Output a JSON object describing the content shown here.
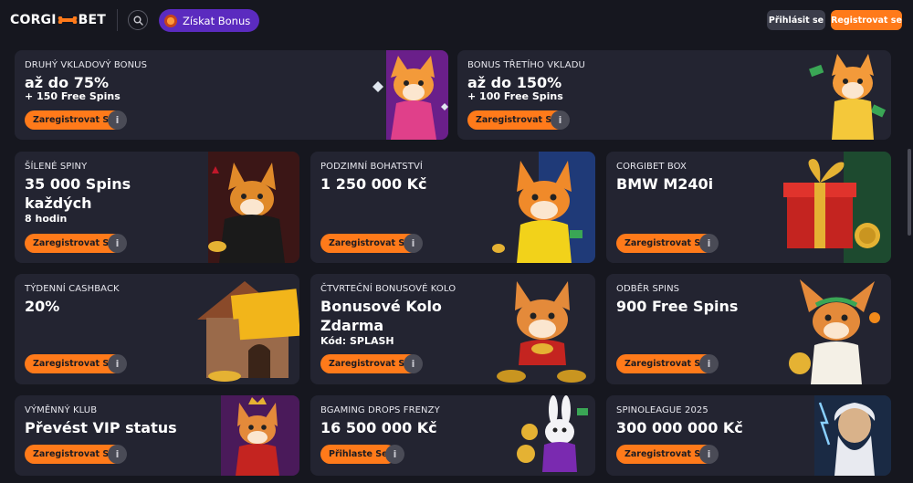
{
  "header": {
    "logo_left": "CORGI",
    "logo_right": "BET",
    "bonus_label": "Získat Bonus",
    "login_label": "Přihlásit se",
    "register_label": "Registrovat se"
  },
  "colors": {
    "accent": "#ff7a1a",
    "card_bg": "#232431",
    "page_bg": "#16171f",
    "bonus_purple": "#5b2bbf"
  },
  "cards": [
    {
      "subtitle": "DRUHÝ VKLADOVÝ BONUS",
      "title": "až do 75%",
      "extra": "+ 150 Free Spins",
      "cta": "Zaregistrovat Se",
      "info": "i",
      "art": "corgi-pink-dress-icon"
    },
    {
      "subtitle": "BONUS TŘETÍHO VKLADU",
      "title": "až do 150%",
      "extra": "+ 100 Free Spins",
      "cta": "Zaregistrovat Se",
      "info": "i",
      "art": "corgi-money-icon"
    },
    {
      "subtitle": "ŠÍLENÉ SPINY",
      "title": "35 000 Spins",
      "title2": "každých",
      "extra": "8 hodin",
      "cta": "Zaregistrovat Se",
      "info": "i",
      "art": "corgi-vampire-icon"
    },
    {
      "subtitle": "PODZIMNÍ BOHATSTVÍ",
      "title": "1 250 000 Kč",
      "cta": "Zaregistrovat Se",
      "info": "i",
      "art": "corgi-yellow-shirt-icon"
    },
    {
      "subtitle": "CORGIBET BOX",
      "title": "BMW M240i",
      "cta": "Zaregistrovat Se",
      "info": "i",
      "art": "gift-box-icon"
    },
    {
      "subtitle": "TÝDENNÍ CASHBACK",
      "title": "20%",
      "cta": "Zaregistrovat Se",
      "info": "i",
      "art": "cashback-house-icon"
    },
    {
      "subtitle": "ČTVRTEČNÍ BONUSOVÉ KOLO",
      "title": "Bonusové Kolo",
      "title2": "Zdarma",
      "extra": "Kód: SPLASH",
      "cta": "Zaregistrovat Se",
      "info": "i",
      "art": "corgi-coins-icon"
    },
    {
      "subtitle": "ODBĚR SPINS",
      "title": "900 Free Spins",
      "cta": "Zaregistrovat Se",
      "info": "i",
      "art": "corgi-laurel-icon"
    },
    {
      "subtitle": "VÝMĚNNÝ KLUB",
      "title": "Převést VIP status",
      "cta": "Zaregistrovat Se",
      "info": "i",
      "art": "corgi-king-icon"
    },
    {
      "subtitle": "BGAMING DROPS FRENZY",
      "title": "16 500 000 Kč",
      "cta": "Přihlaste Se",
      "info": "i",
      "art": "rabbit-icon"
    },
    {
      "subtitle": "SPINOLEAGUE 2025",
      "title": "300 000 000 Kč",
      "cta": "Zaregistrovat Se",
      "info": "i",
      "art": "zeus-icon"
    }
  ]
}
